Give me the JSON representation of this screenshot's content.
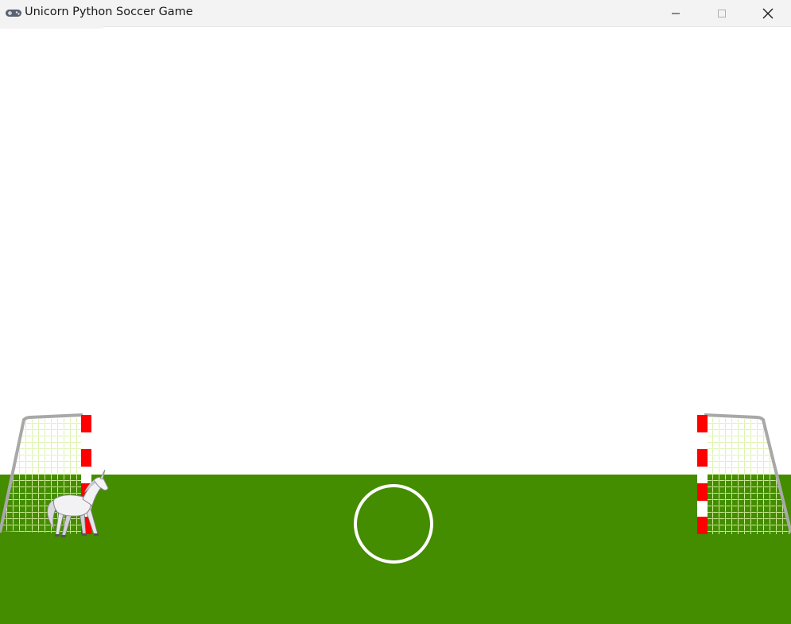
{
  "window": {
    "title": "Unicorn Python Soccer Game",
    "app_icon": "gamepad-icon",
    "controls": [
      "minimize-icon",
      "maximize-icon",
      "close-icon"
    ]
  },
  "scene": {
    "sky_color": "#ffffff",
    "grass_color": "#448c00",
    "center_circle_color": "#ffffff",
    "goal_post_colors": [
      "#ff0000",
      "#ffffff"
    ],
    "net_color": "#d9f2a6",
    "goal_frame_color": "#a8a8a8",
    "player": "unicorn",
    "goals": [
      "left-goal",
      "right-goal"
    ]
  }
}
